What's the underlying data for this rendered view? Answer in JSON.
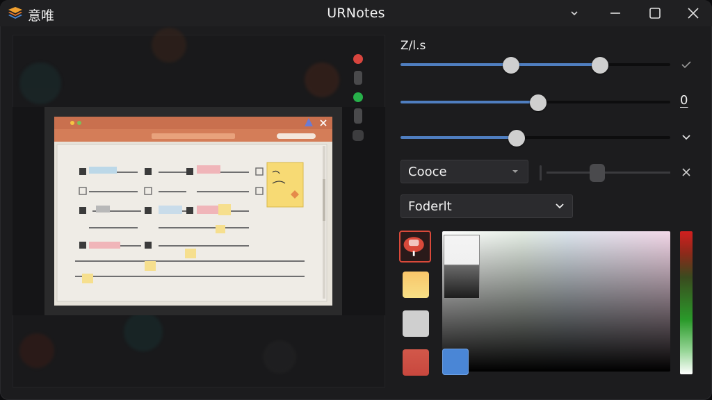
{
  "app": {
    "name": "意唯",
    "title": "URNotes"
  },
  "titlebar": {
    "buttons": [
      {
        "name": "dropdown",
        "icon": "chevron-down-icon"
      },
      {
        "name": "minimize",
        "icon": "minimize-icon"
      },
      {
        "name": "maximize",
        "icon": "maximize-icon"
      },
      {
        "name": "close",
        "icon": "close-icon"
      }
    ]
  },
  "colors": {
    "accent": "#4f7ec0",
    "dot_red": "#d8453e",
    "dot_green": "#27b04a",
    "dot_gray": "#4a4a4c"
  },
  "controls": {
    "section_label": "Z/l.s",
    "slider1": {
      "low": 0.41,
      "high": 0.74,
      "end_icon": "check-icon"
    },
    "slider2": {
      "value": 0.51,
      "value_label": "0"
    },
    "slider3": {
      "value": 0.43,
      "end_icon": "chevron-down-icon"
    },
    "select1": {
      "value": "Cooce"
    },
    "mini_slider": {
      "value": 0.35,
      "end_icon": "close-icon"
    },
    "select2": {
      "value": "Foderlt"
    }
  },
  "swatches": [
    {
      "name": "swatch-red-stamp",
      "color": "#d9493a",
      "selected": true
    },
    {
      "name": "swatch-yellow",
      "color": "#f7cf6a"
    },
    {
      "name": "swatch-light-gray",
      "color": "#cfcfcf"
    },
    {
      "name": "swatch-coral",
      "color": "#cf5a48"
    }
  ]
}
